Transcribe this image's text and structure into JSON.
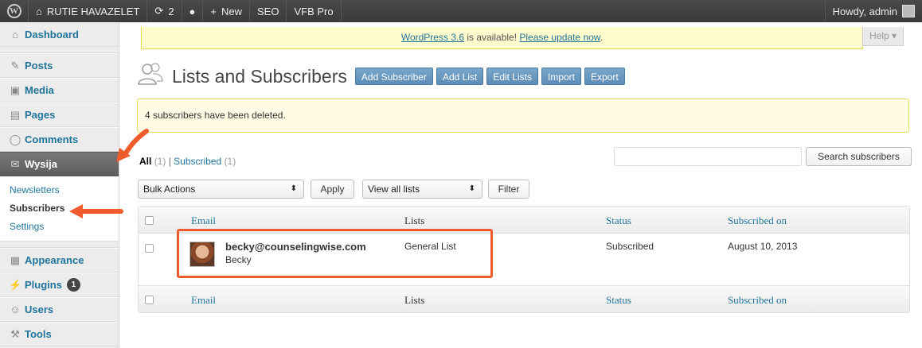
{
  "adminbar": {
    "site_name": "RUTIE HAVAZELET",
    "updates_count": "2",
    "new_label": "New",
    "seo_label": "SEO",
    "vfb_label": "VFB Pro",
    "howdy": "Howdy, admin"
  },
  "sidebar": {
    "dashboard": "Dashboard",
    "posts": "Posts",
    "media": "Media",
    "pages": "Pages",
    "comments": "Comments",
    "wysija": "Wysija",
    "sub_newsletters": "Newsletters",
    "sub_subscribers": "Subscribers",
    "sub_settings": "Settings",
    "appearance": "Appearance",
    "plugins": "Plugins",
    "plugins_badge": "1",
    "users": "Users",
    "tools": "Tools"
  },
  "update_nag": {
    "version_link": "WordPress 3.6",
    "middle": " is available! ",
    "update_link": "Please update now",
    "end": "."
  },
  "help_tab": "Help",
  "page": {
    "title": "Lists and Subscribers",
    "buttons": [
      "Add Subscriber",
      "Add List",
      "Edit Lists",
      "Import",
      "Export"
    ]
  },
  "message": "4 subscribers have been deleted.",
  "filters": {
    "all_label": "All",
    "all_count": "(1)",
    "separator": "|",
    "subscribed_label": "Subscribed",
    "subscribed_count": "(1)"
  },
  "search": {
    "value": "",
    "button": "Search subscribers"
  },
  "bulk": {
    "selected": "Bulk Actions",
    "apply": "Apply",
    "lists_selected": "View all lists",
    "filter": "Filter"
  },
  "table": {
    "headers": {
      "email": "Email",
      "lists": "Lists",
      "status": "Status",
      "subscribed_on": "Subscribed on"
    },
    "rows": [
      {
        "email": "becky@counselingwise.com",
        "name": "Becky",
        "lists": "General List",
        "status": "Subscribed",
        "subscribed_on": "August 10, 2013"
      }
    ]
  },
  "colors": {
    "accent": "#21759b",
    "annotation": "#ef5b2a",
    "admin_bar": "#464646",
    "notice_bg": "#fffbe4"
  }
}
